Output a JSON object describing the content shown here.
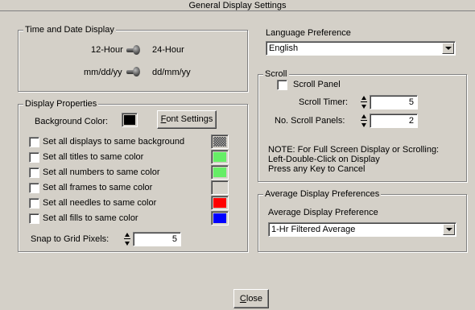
{
  "window": {
    "title": "General Display Settings"
  },
  "time_date": {
    "legend": "Time and Date Display",
    "hour_left": "12-Hour",
    "hour_right": "24-Hour",
    "date_left": "mm/dd/yy",
    "date_right": "dd/mm/yy"
  },
  "display_props": {
    "legend": "Display Properties",
    "bg_color_label": "Background Color:",
    "bg_color": "#000000",
    "font_button_prefix": "",
    "font_button_underlined": "F",
    "font_button_rest": "ont Settings",
    "items": [
      {
        "label": "Set all displays to same background",
        "swatch": "#808080",
        "pattern": true
      },
      {
        "label": "Set all titles to same color",
        "swatch": "#66ee66"
      },
      {
        "label": "Set all numbers to same color",
        "swatch": "#66ee66"
      },
      {
        "label": "Set all frames to same color",
        "swatch": "#d4d0c8"
      },
      {
        "label": "Set all needles to same color",
        "swatch": "#ff0000"
      },
      {
        "label": "Set all fills to same color",
        "swatch": "#0000ff"
      }
    ],
    "snap_label": "Snap to Grid Pixels:",
    "snap_value": "5"
  },
  "language": {
    "label": "Language Preference",
    "selected": "English"
  },
  "scroll": {
    "legend": "Scroll",
    "panel_label": "Scroll Panel",
    "timer_label": "Scroll Timer:",
    "timer_value": "5",
    "panels_label": "No. Scroll Panels:",
    "panels_value": "2",
    "note_1": "NOTE: For Full Screen Display or Scrolling:",
    "note_2": "Left-Double-Click on Display",
    "note_3": "Press any Key to Cancel"
  },
  "average": {
    "legend": "Average Display Preferences",
    "label": "Average Display Preference",
    "selected": "1-Hr Filtered Average"
  },
  "footer": {
    "close_underlined": "C",
    "close_rest": "lose"
  }
}
